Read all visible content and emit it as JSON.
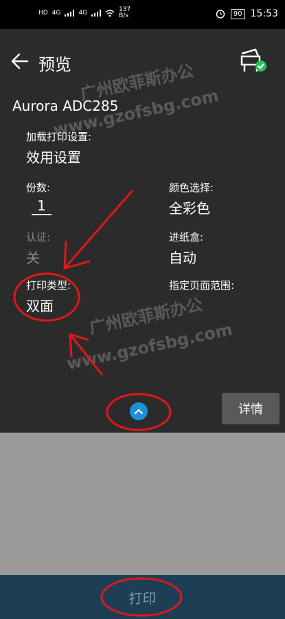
{
  "status_bar": {
    "network_left": "HD",
    "net1": "4G",
    "net2": "4G",
    "speed": "137",
    "speed_unit": "B/s",
    "battery": "90",
    "time": "15:53"
  },
  "header": {
    "title": "预览"
  },
  "printer": {
    "name": "Aurora ADC285"
  },
  "settings": {
    "load_label": "加载打印设置:",
    "load_value": "效用设置",
    "copies_label": "份数:",
    "copies_value": "1",
    "color_label": "颜色选择:",
    "color_value": "全彩色",
    "auth_label": "认证:",
    "auth_value": "关",
    "tray_label": "进纸盒:",
    "tray_value": "自动",
    "print_type_label": "打印类型:",
    "print_type_value": "双面",
    "page_range_label": "指定页面范围:",
    "page_range_value": ""
  },
  "actions": {
    "details": "详情",
    "print": "打印"
  },
  "watermark": {
    "text_cn": "广州欧菲斯办公",
    "text_url": "www.gzofsbg.com"
  },
  "colors": {
    "annotation_red": "#e01818",
    "accent_blue": "#1e90d8",
    "print_bar": "#1c3f55"
  }
}
